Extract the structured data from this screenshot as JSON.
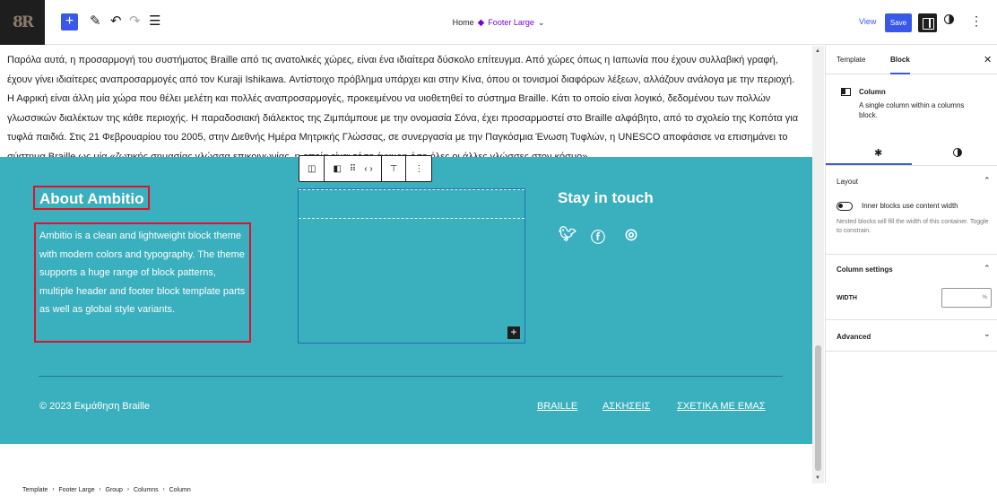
{
  "topbar": {
    "logo_text": "8R",
    "add_label": "+",
    "tools_icon": "pencil-icon",
    "undo_icon": "undo-icon",
    "redo_icon": "redo-icon",
    "document_overview_icon": "list-view-icon",
    "breadcrumb_home": "Home",
    "template_part": "Footer Large",
    "view_label": "View",
    "save_label": "Save"
  },
  "canvas": {
    "paragraph": "Παρόλα αυτά, η προσαρμογή του συστήματος Braille από τις ανατολικές χώρες, είναι ένα ιδιαίτερα δύσκολο επίτευγμα. Από χώρες όπως η Ιαπωνία που έχουν συλλαβική γραφή, έχουν γίνει ιδιαίτερες αναπροσαρμογές από τον Kuraji Ishikawa. Αντίστοιχο πρόβλημα υπάρχει και στην Κίνα, όπου οι τονισμοί διαφόρων λέξεων, αλλάζουν ανάλογα με την περιοχή. Η Αφρική είναι άλλη μία χώρα που θέλει μελέτη και πολλές αναπροσαρμογές, προκειμένου να υιοθετηθεί το σύστημα Braille. Κάτι το οποίο είναι λογικό, δεδομένου των πολλών γλωσσικών διαλέκτων της κάθε περιοχής. Η παραδοσιακή διάλεκτος της Ζιμπάμπουε με την ονομασία Σόνα, έχει προσαρμοστεί στο Braille αλφάβητο, από το σχολείο της Κοπότα για τυφλά παιδιά. Στις 21 Φεβρουαρίου του 2005, στην Διεθνής Ημέρα Μητρικής Γλώσσας, σε συνεργασία με την Παγκόσμια Ένωση Τυφλών, η UNESCO αποφάσισε να επισημάνει το σύστημα Braille ως μία «ζωτικής σημασίας γλώσσα επικοινωνίας, η οποία είναι τόσο έγκυρη όσο όλες οι άλλες γλώσσες στον κόσμο»"
  },
  "footer": {
    "background_color": "#3aafbd",
    "about_heading": "About Ambitio",
    "about_text": "Ambitio is a clean and lightweight block theme with modern colors and typography. The theme supports a huge range of block patterns, multiple header and footer block template parts as well as global style variants.",
    "stay_heading": "Stay in touch",
    "social": [
      "twitter-icon",
      "facebook-icon",
      "instagram-icon"
    ],
    "copyright": "© 2023 Εκμάθηση Braille",
    "links": [
      "BRAILLE",
      "ΑΣΚΗΣΕΙΣ",
      "ΣΧΕΤΙΚΑ ΜΕ ΕΜΑΣ"
    ]
  },
  "block_toolbar": {
    "buttons": [
      "columns-icon",
      "column-icon",
      "drag-handle-icon",
      "move-arrows-icon",
      "align-top-icon",
      "more-options-icon"
    ]
  },
  "sidebar": {
    "tab_template": "Template",
    "tab_block": "Block",
    "block_name": "Column",
    "block_description": "A single column within a columns block.",
    "layout_heading": "Layout",
    "toggle_label": "Inner blocks use content width",
    "toggle_help": "Nested blocks will fill the width of this container. Toggle to constrain.",
    "column_settings_heading": "Column settings",
    "width_label": "WIDTH",
    "width_unit": "%",
    "advanced_heading": "Advanced"
  },
  "breadcrumb": [
    "Template",
    "Footer Large",
    "Group",
    "Columns",
    "Column"
  ],
  "colors": {
    "accent": "#3858e9",
    "selection_outline": "#e0112a"
  }
}
